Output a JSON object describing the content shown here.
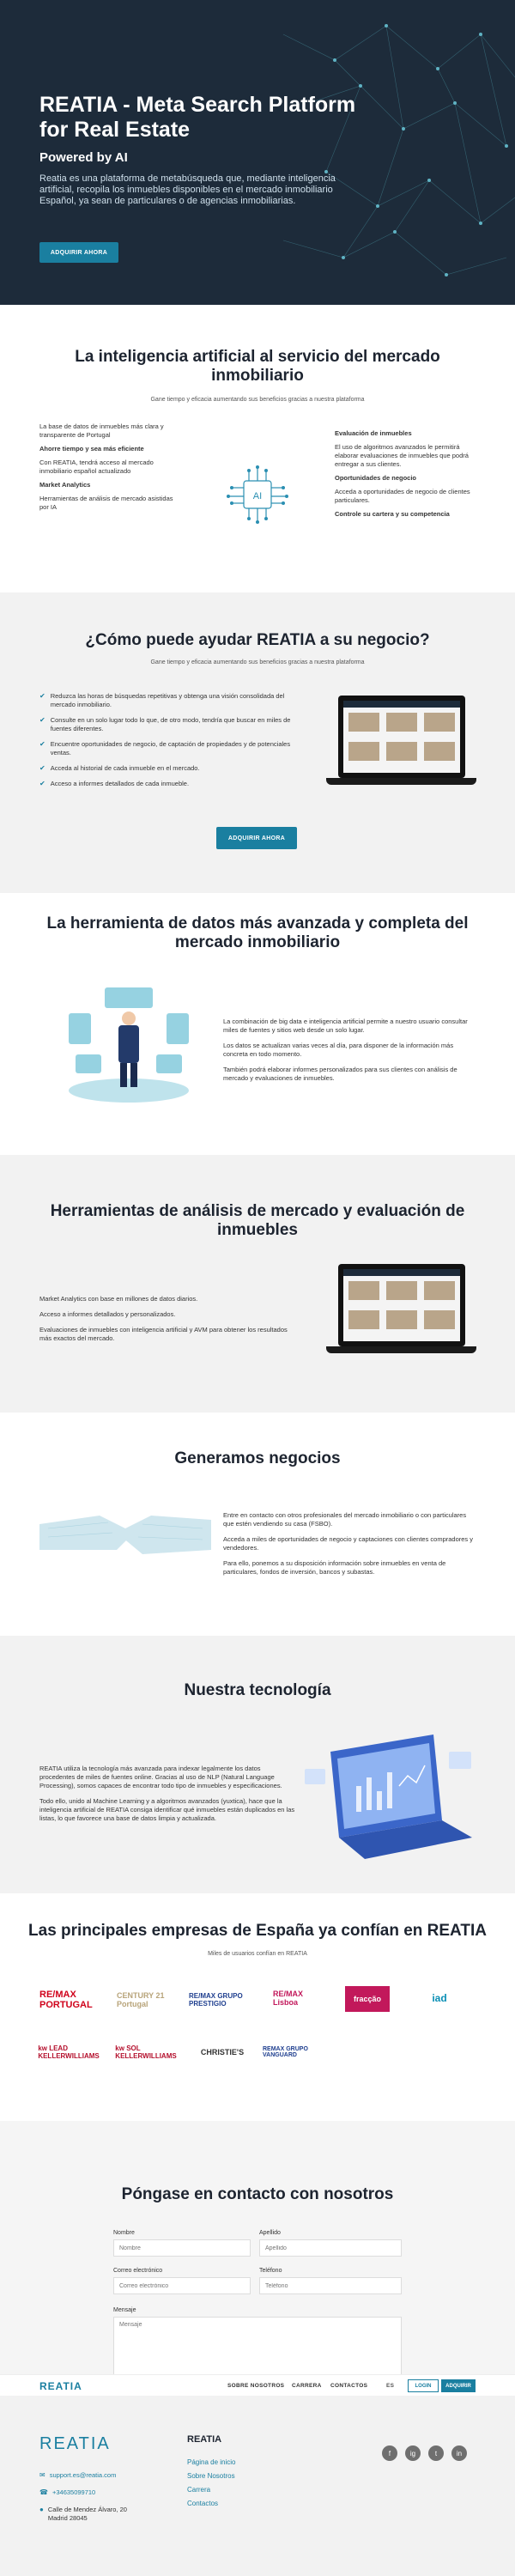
{
  "hero": {
    "title": "REATIA - Meta Search Platform for Real Estate",
    "subtitle": "Powered by AI",
    "text": "Reatia es una plataforma de metabúsqueda que, mediante inteligencia artificial, recopila los inmuebles disponibles en el mercado inmobiliario Español, ya sean de particulares o de agencias inmobiliarias.",
    "cta": "ADQUIRIR AHORA"
  },
  "ai_section": {
    "title": "La inteligencia artificial al servicio del mercado inmobiliario",
    "lead": "Gane tiempo y eficacia aumentando sus beneficios gracias a nuestra plataforma",
    "left": [
      "La base de datos de inmuebles más clara y transparente de Portugal",
      "Ahorre tiempo y sea más eficiente",
      "Con REATIA, tendrá acceso al mercado inmobiliario español actualizado",
      "Market Analytics",
      "Herramientas de análisis de mercado asistidas por IA"
    ],
    "right": [
      "Evaluación de inmuebles",
      "El uso de algoritmos avanzados le permitirá elaborar evaluaciones de inmuebles que podrá entregar a sus clientes.",
      "Oportunidades de negocio",
      "Acceda a oportunidades de negocio de clientes particulares.",
      "Controle su cartera y su competencia"
    ],
    "chip_label": "AI"
  },
  "help_section": {
    "title": "¿Cómo puede ayudar REATIA a su negocio?",
    "lead": "Gane tiempo y eficacia aumentando sus beneficios gracias a nuestra plataforma",
    "items": [
      "Reduzca las horas de búsquedas repetitivas y obtenga una visión consolidada del mercado inmobiliario.",
      "Consulte en un solo lugar todo lo que, de otro modo, tendría que buscar en miles de fuentes diferentes.",
      "Encuentre oportunidades de negocio, de captación de propiedades y de potenciales ventas.",
      "Acceda al historial de cada inmueble en el mercado.",
      "Acceso a informes detallados de cada inmueble."
    ],
    "cta": "ADQUIRIR AHORA"
  },
  "tool_section": {
    "title": "La herramienta de datos más avanzada y completa del mercado inmobiliario",
    "paragraphs": [
      "La combinación de big data e inteligencia artificial permite a nuestro usuario consultar miles de fuentes y sitios web desde un solo lugar.",
      "Los datos se actualizan varias veces al día, para disponer de la información más concreta en todo momento.",
      "También podrá elaborar informes personalizados para sus clientes con análisis de mercado y evaluaciones de inmuebles."
    ]
  },
  "analysis_section": {
    "title": "Herramientas de análisis de mercado y evaluación de inmuebles",
    "paragraphs": [
      "Market Analytics con base en millones de datos diarios.",
      "Acceso a informes detallados y personalizados.",
      "Evaluaciones de inmuebles con inteligencia artificial y AVM para obtener los resultados más exactos del mercado."
    ]
  },
  "business_section": {
    "title": "Generamos negocios",
    "paragraphs": [
      "Entre en contacto con otros profesionales del mercado inmobiliario o con particulares que estén vendiendo su casa (FSBO).",
      "Acceda a miles de oportunidades de negocio y captaciones con clientes compradores y vendedores.",
      "Para ello, ponemos a su disposición información sobre inmuebles en venta de particulares, fondos de inversión, bancos y subastas."
    ]
  },
  "tech_section": {
    "title": "Nuestra tecnología",
    "paragraphs": [
      "REATIA utiliza la tecnología más avanzada para indexar legalmente los datos procedentes de miles de fuentes online. Gracias al uso de NLP (Natural Language Processing), somos capaces de encontrar todo tipo de inmuebles y especificaciones.",
      "Todo ello, unido al Machine Learning y a algoritmos avanzados (yuxtica), hace que la inteligencia artificial de REATIA consiga identificar qué inmuebles están duplicados en las listas, lo que favorece una base de datos limpia y actualizada."
    ]
  },
  "clients_section": {
    "title": "Las principales empresas de España ya confían en REATIA",
    "lead": "Miles de usuarios confían en REATIA",
    "logos": [
      "RE/MAX PORTUGAL",
      "CENTURY 21 Portugal",
      "RE/MAX GRUPO PRESTIGIO",
      "RE/MAX Lisboa",
      "fracção",
      "iad",
      "kw LEAD KELLERWILLIAMS",
      "kw SOL KELLERWILLIAMS",
      "CHRISTIE'S",
      "REMAX GRUPO VANGUARD"
    ]
  },
  "contact_section": {
    "title": "Póngase en contacto con nosotros",
    "fields": {
      "name_label": "Nombre",
      "name_placeholder": "Nombre",
      "surname_label": "Apellido",
      "surname_placeholder": "Apellido",
      "email_label": "Correo electrónico",
      "email_placeholder": "Correo electrónico",
      "phone_label": "Teléfono",
      "phone_placeholder": "Teléfono",
      "message_label": "Mensaje",
      "message_placeholder": "Mensaje"
    }
  },
  "header": {
    "logo": "REATIA",
    "nav": [
      "SOBRE NOSOTROS",
      "CARRERA",
      "CONTACTOS"
    ],
    "language": "ES",
    "login": "LOGIN",
    "register": "ADQUIRIR"
  },
  "footer": {
    "logo": "REATIA",
    "email": "support.es@reatia.com",
    "phone": "+34635099710",
    "address": "Calle de Mendez Álvaro, 20 Madrid 28045",
    "column_title": "REATIA",
    "links": [
      "Página de inicio",
      "Sobre Nosotros",
      "Carrera",
      "Contactos"
    ],
    "social": [
      "f",
      "ig",
      "t",
      "in"
    ]
  },
  "colors": {
    "accent": "#1a7fa0",
    "hero_bg": "#1d2b3a",
    "section_gray": "#f2f2f2"
  }
}
